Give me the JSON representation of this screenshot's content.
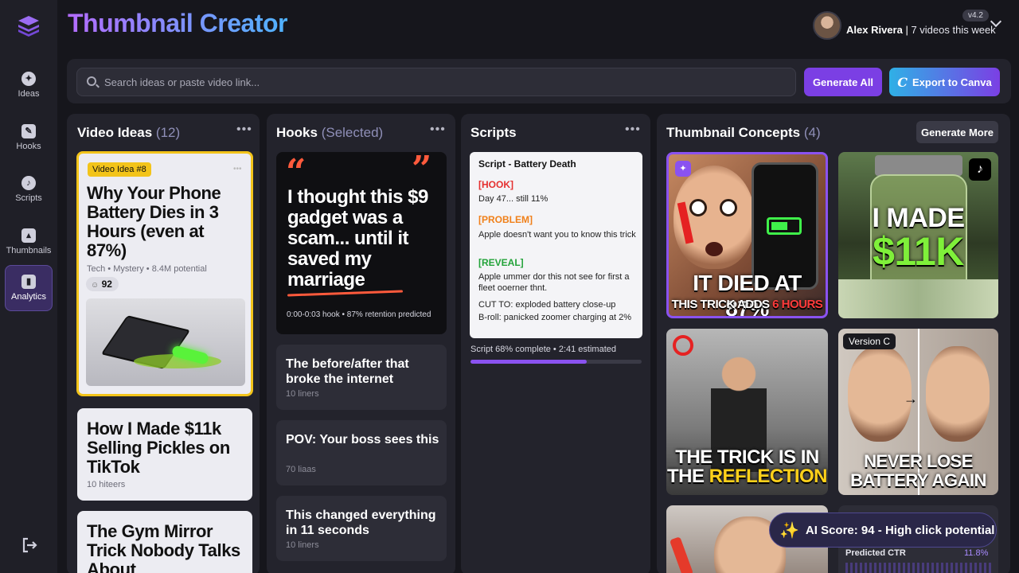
{
  "app": {
    "title": "Thumbnail Creator",
    "version": "v4.2"
  },
  "user": {
    "name": "Alex Rivera",
    "stat": "7 videos this week"
  },
  "sidebar": {
    "items": [
      {
        "label": "Ideas",
        "icon": "lightbulb-icon"
      },
      {
        "label": "Hooks",
        "icon": "pen-icon"
      },
      {
        "label": "Scripts",
        "icon": "music-note-icon"
      },
      {
        "label": "Thumbnails",
        "icon": "image-icon"
      },
      {
        "label": "Analytics",
        "icon": "bar-chart-icon",
        "active": true
      }
    ]
  },
  "toolbar": {
    "search_placeholder": "Search ideas or paste video link...",
    "generate_all": "Generate All",
    "export_canva": "Export to Canva"
  },
  "columns": {
    "ideas": {
      "title": "Video Ideas",
      "count": "(12)",
      "cards": [
        {
          "tag": "Video Idea #8",
          "title": "Why Your Phone Battery Dies in 3 Hours (even at 87%)",
          "category": "Tech",
          "genre": "Mystery",
          "potential": "8.4M potential",
          "score": "92"
        },
        {
          "title": "How I Made $11k Selling Pickles on TikTok",
          "hooks": "10 hiteers"
        },
        {
          "title": "The Gym Mirror Trick Nobody Talks About"
        }
      ]
    },
    "hooks": {
      "title": "Hooks",
      "selected": "(Selected)",
      "featured": {
        "quote": "I thought this $9 gadget was a scam... until it saved my marriage",
        "meta": "0:00-0:03 hook • 87% retention predicted"
      },
      "cards": [
        {
          "title": "The before/after that broke the internet",
          "hooks": "10 liners"
        },
        {
          "title": "POV: Your boss sees this",
          "hooks": "70 liaas"
        },
        {
          "title": "This changed everything in 11 seconds",
          "hooks": "10 liners"
        }
      ]
    },
    "scripts": {
      "title": "Scripts",
      "card_title": "Script - Battery Death",
      "hook_label": "[HOOK]",
      "hook_text": "Day 47... still 11%",
      "problem_label": "[PROBLEM]",
      "problem_text": "Apple doesn't want you to know this trick",
      "reveal_label": "[REVEAL]",
      "reveal_text": "Apple ummer dor this not see for first a fleet ooerner thnt.",
      "cut_text": "CUT TO: exploded battery close-up",
      "broll_text": "B-roll: panicked zoomer charging at 2%",
      "progress_text": "Script 68% complete • 2:41 estimated",
      "progress": 0.68
    },
    "thumbnails": {
      "title": "Thumbnail Concepts",
      "count": "(4)",
      "generate_more": "Generate More",
      "concepts": [
        {
          "line1": "IT DIED AT 87%",
          "line2a": "THIS TRICK ADDS ",
          "line2b": "6 HOURS"
        },
        {
          "line1": "I MADE",
          "line2": "$11K"
        },
        {
          "line1": "THE TRICK IS IN",
          "line2a": "THE ",
          "line2b": "REFLECTION"
        },
        {
          "badge": "Version C",
          "line1": "NEVER LOSE",
          "line2": "BATTERY AGAIN"
        }
      ],
      "ai_score": "AI Score: 94 - High click potential",
      "ctr_label": "Predicted CTR",
      "ctr_value": "11.8%"
    }
  },
  "colors": {
    "accent": "#7b3fe4",
    "highlight": "#f3c41a",
    "bg": "#16161c"
  }
}
